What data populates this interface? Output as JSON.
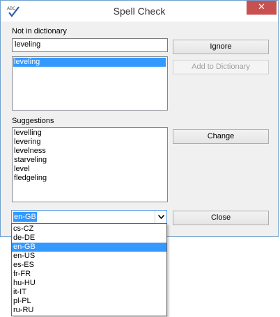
{
  "window": {
    "title": "Spell Check",
    "close_glyph": "✕"
  },
  "not_in_dictionary": {
    "label": "Not in dictionary",
    "value": "leveling",
    "items": [
      "leveling"
    ]
  },
  "buttons": {
    "ignore": "Ignore",
    "add_to_dictionary": "Add to Dictionary",
    "change": "Change",
    "close": "Close"
  },
  "suggestions": {
    "label": "Suggestions",
    "items": [
      "levelling",
      "levering",
      "levelness",
      "starveling",
      "level",
      "fledgeling"
    ]
  },
  "language": {
    "selected": "en-GB",
    "options": [
      "cs-CZ",
      "de-DE",
      "en-GB",
      "en-US",
      "es-ES",
      "fr-FR",
      "hu-HU",
      "it-IT",
      "pl-PL",
      "ru-RU"
    ]
  },
  "icons": {
    "app": "abc-checkmark-icon",
    "dropdown": "chevron-down-icon"
  },
  "colors": {
    "selection": "#3399ff",
    "close_button": "#c75050"
  }
}
